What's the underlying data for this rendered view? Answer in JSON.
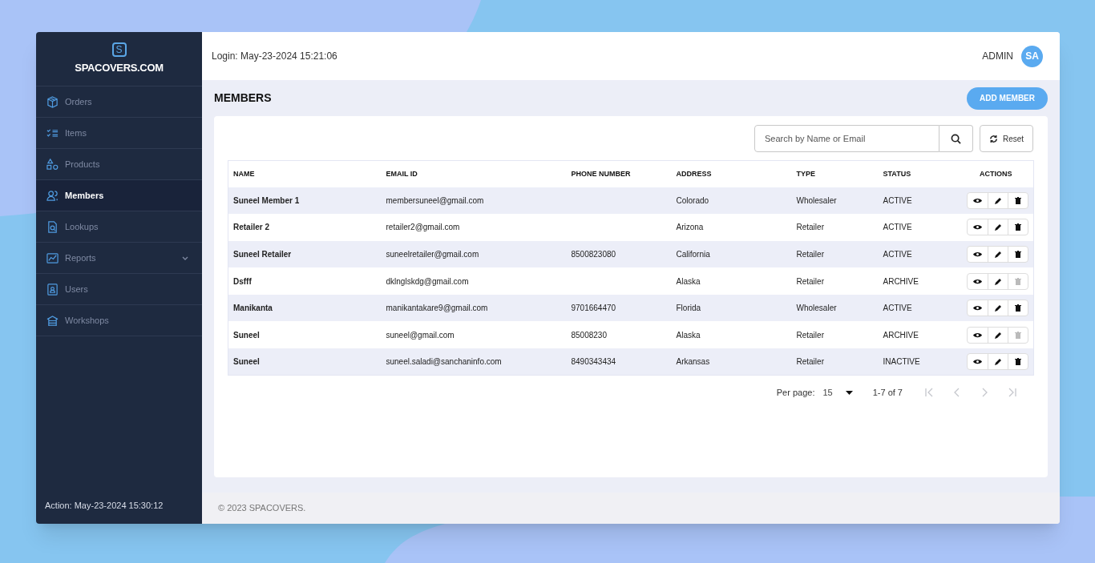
{
  "brand": {
    "mark": "S",
    "name": "SPACOVERS.COM"
  },
  "sidebar": {
    "items": [
      {
        "label": "Orders",
        "selected": false,
        "kind": "link"
      },
      {
        "label": "Items",
        "selected": false,
        "kind": "link"
      },
      {
        "label": "Products",
        "selected": false,
        "kind": "link"
      },
      {
        "label": "Members",
        "selected": true,
        "kind": "link"
      },
      {
        "label": "Lookups",
        "selected": false,
        "kind": "link"
      },
      {
        "label": "Reports",
        "selected": false,
        "kind": "group"
      },
      {
        "label": "Users",
        "selected": false,
        "kind": "link"
      },
      {
        "label": "Workshops",
        "selected": false,
        "kind": "link"
      }
    ],
    "footer": "Action: May-23-2024 15:30:12"
  },
  "header": {
    "login": "Login: May-23-2024 15:21:06",
    "user": "ADMIN",
    "avatar": "SA"
  },
  "page": {
    "title": "MEMBERS",
    "add_button": "ADD MEMBER"
  },
  "search": {
    "placeholder": "Search by Name or Email",
    "reset": "Reset"
  },
  "table": {
    "columns": [
      "NAME",
      "EMAIL ID",
      "PHONE NUMBER",
      "ADDRESS",
      "TYPE",
      "STATUS",
      "ACTIONS"
    ],
    "rows": [
      {
        "name": "Suneel Member 1",
        "email": "membersuneel@gmail.com",
        "address": "Colorado",
        "type": "Wholesaler",
        "status": "ACTIVE",
        "delete_disabled": false
      },
      {
        "name": "Retailer 2",
        "email": "retailer2@gmail.com",
        "address": "Arizona",
        "type": "Retailer",
        "status": "ACTIVE",
        "delete_disabled": false
      },
      {
        "name": "Suneel Retailer",
        "email": "suneelretailer@gmail.com",
        "phone": "8500823080",
        "address": "California",
        "type": "Retailer",
        "status": "ACTIVE",
        "delete_disabled": false
      },
      {
        "name": "Dsfff",
        "email": "dklnglskdg@gmail.com",
        "address": "Alaska",
        "type": "Retailer",
        "status": "ARCHIVE",
        "delete_disabled": true
      },
      {
        "name": "Manikanta",
        "email": "manikantakare9@gmail.com",
        "phone": "9701664470",
        "address": "Florida",
        "type": "Wholesaler",
        "status": "ACTIVE",
        "delete_disabled": false
      },
      {
        "name": "Suneel",
        "email": "suneel@gmail.com",
        "phone": "85008230",
        "address": "Alaska",
        "type": "Retailer",
        "status": "ARCHIVE",
        "delete_disabled": true
      },
      {
        "name": "Suneel",
        "email": "suneel.saladi@sanchaninfo.com",
        "phone": "8490343434",
        "address": "Arkansas",
        "type": "Retailer",
        "status": "INACTIVE",
        "delete_disabled": false
      }
    ]
  },
  "pagination": {
    "per_page_label": "Per page:",
    "per_page": "15",
    "range": "1-7 of 7",
    "buttons": [
      {
        "kind": "first",
        "disabled": true
      },
      {
        "kind": "prev",
        "disabled": true
      },
      {
        "kind": "next",
        "disabled": true
      },
      {
        "kind": "last",
        "disabled": true
      }
    ]
  },
  "footer": "© 2023 SPACOVERS."
}
